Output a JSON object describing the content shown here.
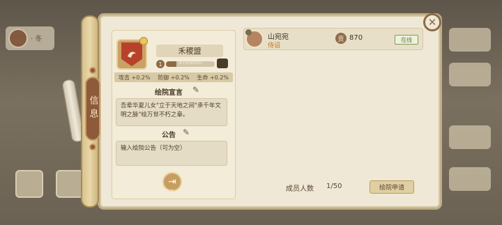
{
  "side_tab": {
    "label": "信息"
  },
  "guild": {
    "name": "禾稷盟",
    "level": "1",
    "exp_text": "870/4000",
    "exp_progress": 0.2175,
    "stats": [
      "攻击 +0.2%",
      "防御 +0.2%",
      "生命 +0.2%"
    ]
  },
  "declaration": {
    "title": "绘院宣言",
    "text": "吾辈华夏儿女\"立于天地之间\"承千年文明之脉\"绘万世不朽之章。"
  },
  "notice": {
    "title": "公告",
    "placeholder": "输入绘院公告（可为空）"
  },
  "exit": {
    "label": "退出"
  },
  "members": [
    {
      "name": "山宛宛",
      "role": "侍诏",
      "contribution_icon": "贡",
      "contribution": "870",
      "status": "在线"
    }
  ],
  "footer": {
    "member_count_label": "成员人数",
    "member_count_value": "1/50",
    "apply_button": "绘院申请"
  },
  "background": {
    "left_card_text": "· 冬"
  },
  "colors": {
    "accent_brown": "#8d5a3a",
    "online_green": "#5c7c3a",
    "role_orange": "#b57a2a"
  },
  "icons": [
    "close-icon",
    "pen-icon",
    "exit-icon",
    "chest-icon",
    "contribution-icon"
  ]
}
